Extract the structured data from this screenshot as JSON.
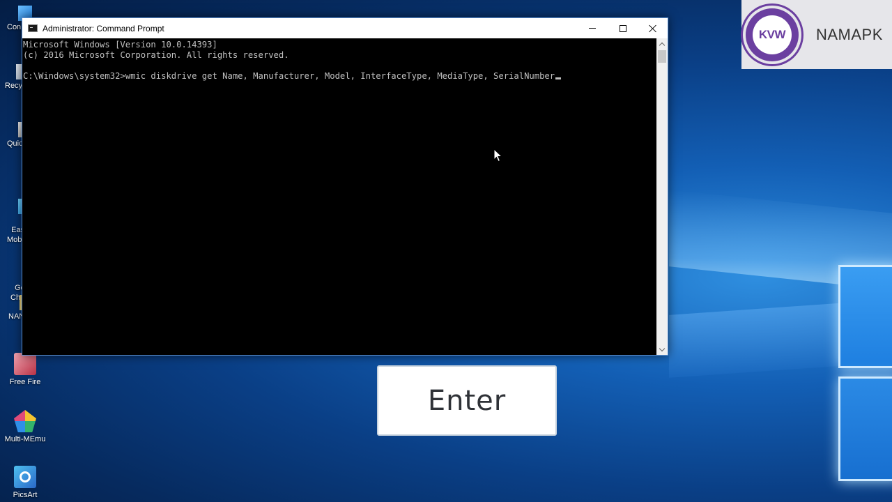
{
  "window": {
    "title": "Administrator: Command Prompt",
    "icon": "cmd-icon"
  },
  "console": {
    "lines": [
      "Microsoft Windows [Version 10.0.14393]",
      "(c) 2016 Microsoft Corporation. All rights reserved.",
      "",
      "C:\\Windows\\system32>wmic diskdrive get Name, Manufacturer, Model, InterfaceType, MediaType, SerialNumber"
    ]
  },
  "desktop": {
    "partial_icons": [
      "Con",
      "Recy",
      "Quic",
      "Eas\nMob",
      "Go\nChr",
      "NAN"
    ],
    "icons": [
      {
        "label": "Free Fire",
        "icon": "free-fire-icon",
        "color": "#d34a5a"
      },
      {
        "label": "Multi-MEmu",
        "icon": "multi-memu-icon",
        "color": "#3aa0e8"
      },
      {
        "label": "PicsArt",
        "icon": "picsart-icon",
        "color": "#3b8fd6"
      }
    ]
  },
  "watermark": {
    "badge": "KVW",
    "brand": "NAMAPK"
  },
  "key_overlay": {
    "label": "Enter"
  },
  "colors": {
    "console_bg": "#000000",
    "console_text": "#c0c0c0",
    "badge_purple": "#6b3fa0"
  }
}
